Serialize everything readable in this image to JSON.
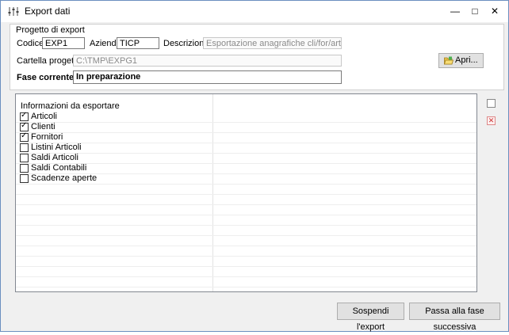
{
  "window": {
    "title": "Export dati",
    "minimize_glyph": "—",
    "maximize_glyph": "□",
    "close_glyph": "✕"
  },
  "project_group": {
    "title": "Progetto di export",
    "codice_label": "Codice:",
    "codice_value": "EXP1",
    "azienda_label": "Azienda",
    "azienda_value": "TICP",
    "descrizione_label": "Descrizione:",
    "descrizione_value": "Esportazione anagrafiche cli/for/art",
    "cartella_label": "Cartella progetto:",
    "cartella_value": "C:\\TMP\\EXPG1",
    "apri_label": "Apri...",
    "fase_label": "Fase corrente:",
    "fase_value": "In preparazione"
  },
  "export_list": {
    "header": "Informazioni da esportare",
    "items": [
      {
        "label": "Articoli",
        "checked": true
      },
      {
        "label": "Clienti",
        "checked": true
      },
      {
        "label": "Fornitori",
        "checked": true
      },
      {
        "label": "Listini Articoli",
        "checked": false
      },
      {
        "label": "Saldi Articoli",
        "checked": false
      },
      {
        "label": "Saldi Contabili",
        "checked": false
      },
      {
        "label": "Scadenze aperte",
        "checked": false
      }
    ]
  },
  "footer": {
    "sospendi_label": "Sospendi l'export",
    "passa_label": "Passa alla fase successiva"
  },
  "colors": {
    "window_border": "#6b8fbf",
    "background": "#f0f0f0",
    "delete_icon": "#cc3333"
  }
}
